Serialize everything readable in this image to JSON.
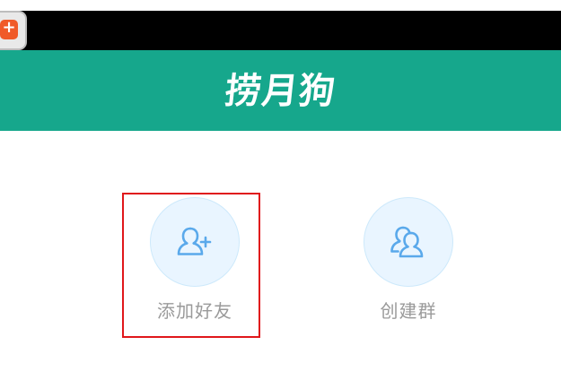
{
  "app": {
    "title": "捞月狗"
  },
  "actions": {
    "add_friend": {
      "label": "添加好友",
      "icon": "add-user-icon"
    },
    "create_group": {
      "label": "创建群",
      "icon": "group-icon"
    }
  },
  "colors": {
    "header": "#16a78c",
    "status_bar": "#000000",
    "icon_circle": "#e9f5ff",
    "icon_stroke": "#5aa9eb",
    "label_text": "#9a9a9a",
    "highlight": "#e0171b"
  }
}
